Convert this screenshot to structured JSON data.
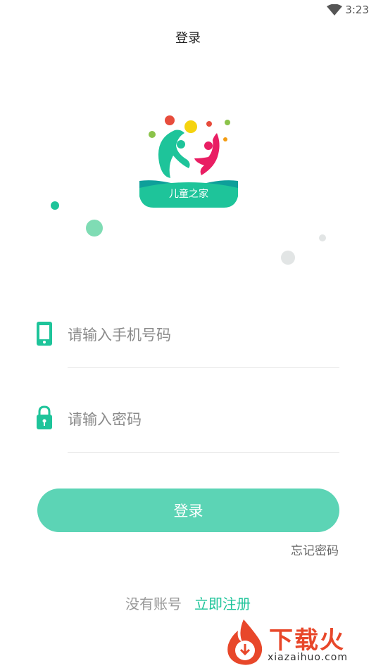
{
  "status_bar": {
    "time": "3:23"
  },
  "header": {
    "title": "登录"
  },
  "logo": {
    "text": "儿童之家"
  },
  "form": {
    "phone_placeholder": "请输入手机号码",
    "password_placeholder": "请输入密码",
    "login_label": "登录",
    "forgot_label": "忘记密码"
  },
  "footer": {
    "no_account": "没有账号",
    "register": "立即注册"
  },
  "watermark": {
    "brand": "下载火",
    "url": "xiazaihuo.com"
  },
  "colors": {
    "accent": "#5cd4b5",
    "link": "#1ec49a",
    "brand_red": "#e8472a"
  }
}
